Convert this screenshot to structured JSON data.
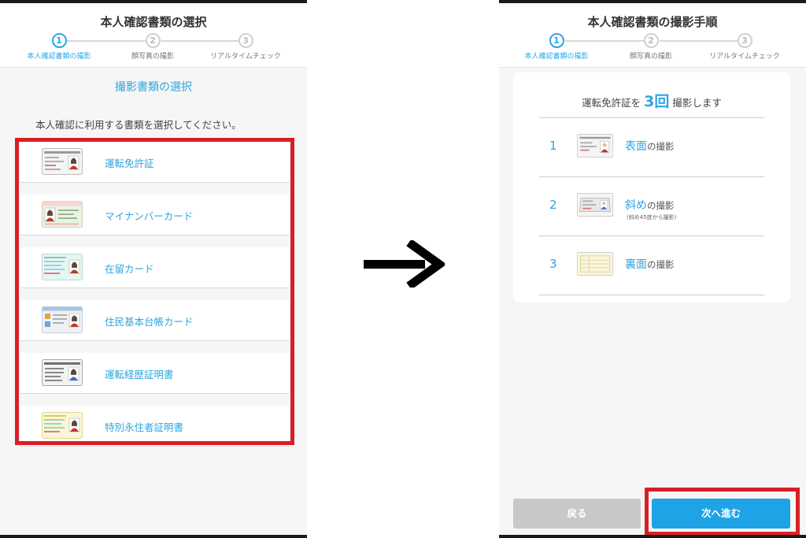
{
  "left": {
    "header_title": "本人確認書類の選択",
    "steps": [
      {
        "num": "1",
        "label": "本人確認書類の撮影"
      },
      {
        "num": "2",
        "label": "顔写真の撮影"
      },
      {
        "num": "3",
        "label": "リアルタイムチェック"
      }
    ],
    "section_title": "撮影書類の選択",
    "instruction": "本人確認に利用する書類を選択してください。",
    "documents": [
      {
        "label": "運転免許証",
        "icon": "drivers-license-icon"
      },
      {
        "label": "マイナンバーカード",
        "icon": "my-number-card-icon"
      },
      {
        "label": "在留カード",
        "icon": "residence-card-icon"
      },
      {
        "label": "住民基本台帳カード",
        "icon": "resident-registry-card-icon"
      },
      {
        "label": "運転経歴証明書",
        "icon": "driving-history-certificate-icon"
      },
      {
        "label": "特別永住者証明書",
        "icon": "special-permanent-resident-certificate-icon"
      }
    ]
  },
  "right": {
    "header_title": "本人確認書類の撮影手順",
    "steps": [
      {
        "num": "1",
        "label": "本人確認書類の撮影"
      },
      {
        "num": "2",
        "label": "顔写真の撮影"
      },
      {
        "num": "3",
        "label": "リアルタイムチェック"
      }
    ],
    "summary_pre": "運転免許証を",
    "summary_count": "3回",
    "summary_post": "撮影します",
    "shots": [
      {
        "num": "1",
        "highlight": "表面",
        "suffix": "の撮影",
        "note": ""
      },
      {
        "num": "2",
        "highlight": "斜め",
        "suffix": "の撮影",
        "note": "(斜め45度から撮影)"
      },
      {
        "num": "3",
        "highlight": "裏面",
        "suffix": "の撮影",
        "note": ""
      }
    ],
    "back_label": "戻る",
    "next_label": "次へ進む"
  },
  "colors": {
    "accent": "#2ba6e1",
    "highlight_frame": "#d91f26",
    "next_button": "#1ea3e6",
    "back_button": "#c8c8c8"
  }
}
